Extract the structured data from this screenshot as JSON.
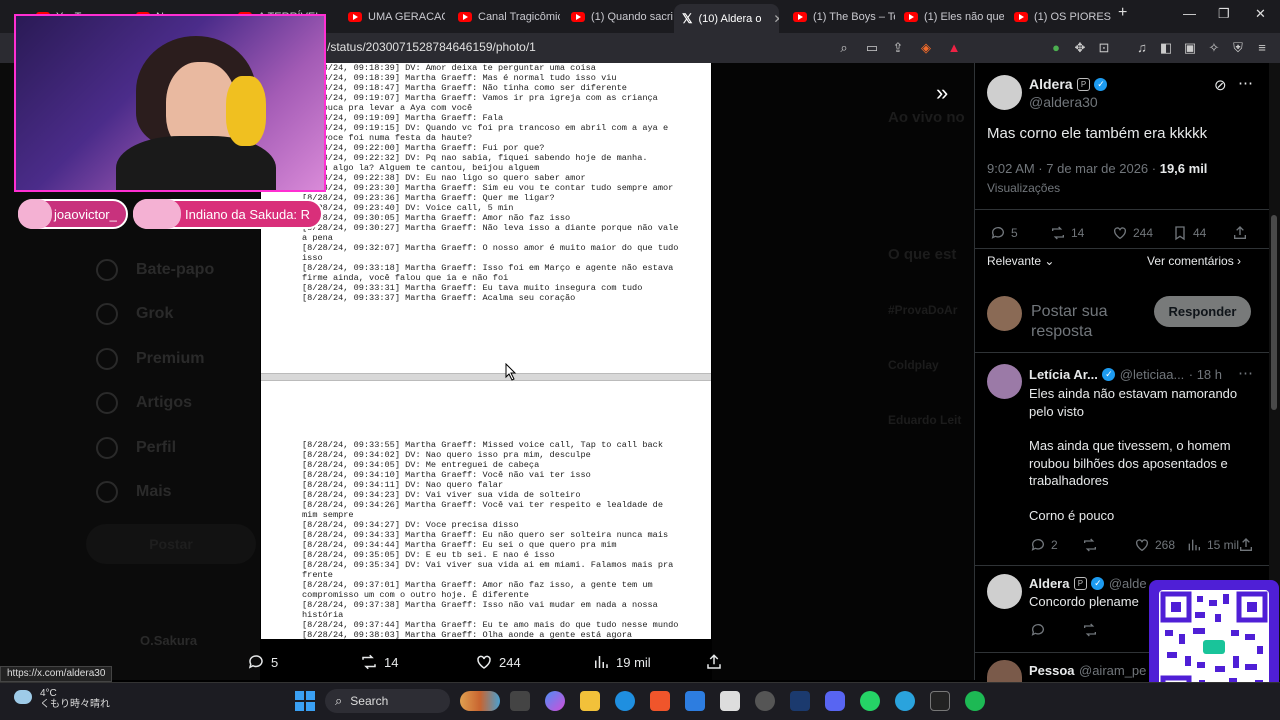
{
  "browser": {
    "tabs": [
      {
        "label": "YouTube"
      },
      {
        "label": "N..."
      },
      {
        "label": "A TERRÍVEL..."
      },
      {
        "label": "UMA GERACAO"
      },
      {
        "label": "Canal Tragicômic"
      },
      {
        "label": "(1) Quando sacri"
      },
      {
        "label": "(10) Aldera o"
      },
      {
        "label": "(1) The Boys – Te"
      },
      {
        "label": "(1) Eles não que"
      },
      {
        "label": "(1) OS PIORES D"
      }
    ],
    "new_tab": "+",
    "url": "/status/2030071528784646159/photo/1",
    "status_url": "https://x.com/aldera30"
  },
  "left_nav": {
    "items": [
      "Bate-papo",
      "Grok",
      "Premium",
      "Artigos",
      "Perfil",
      "Mais"
    ],
    "post_button": "Postar",
    "user": "O.Sakura"
  },
  "background_trends": {
    "live": "Ao vivo no",
    "section": "O que est",
    "items": [
      "#ProvaDoAr",
      "Coldplay",
      "Eduardo Leit"
    ]
  },
  "document": {
    "page1": [
      "[8/28/24, 09:18:39] DV: Amor deixa te perguntar uma coisa",
      "[8/28/24, 09:18:39] Martha Graeff: Mas é normal tudo isso viu",
      "[8/28/24, 09:18:47] Martha Graeff: Não tinha como ser diferente",
      "[8/28/24, 09:19:07] Martha Graeff: Vamos ir pra igreja com as criança",
      "e! Louca pra levar a Aya com você",
      "[8/28/24, 09:19:09] Martha Graeff: Fala",
      "[8/28/24, 09:19:15] DV: Quando vc foi pra trancoso em abril com a aya e",
      "ae, voce foi numa festa da haute?",
      "[8/28/24, 09:22:00] Martha Graeff: Fui por que?",
      "[8/28/24, 09:22:32] DV: Pq nao sabia, fiquei sabendo hoje de manha.",
      "teceu algo la? Alguem te cantou, beijou alguem",
      "[8/28/24, 09:22:38] DV: Eu nao ligo so quero saber amor",
      "[8/28/24, 09:23:30] Martha Graeff: Sim eu vou te contar tudo sempre amor",
      "[8/28/24, 09:23:36] Martha Graeff: Quer me ligar?",
      "[8/28/24, 09:23:40] DV: Voice call, 5 min",
      "[8/28/24, 09:30:05] Martha Graeff: Amor não faz isso",
      "[8/28/24, 09:30:27] Martha Graeff: Não leva isso a diante porque não vale",
      "a pena",
      "[8/28/24, 09:32:07] Martha Graeff: O nosso amor é muito maior do que tudo",
      "isso",
      "[8/28/24, 09:33:18] Martha Graeff: Isso foi em Março e agente não estava",
      "firme ainda, você falou que ia e não foi",
      "[8/28/24, 09:33:31] Martha Graeff: Eu tava muito insegura com tudo",
      "[8/28/24, 09:33:37] Martha Graeff: Acalma seu coração"
    ],
    "page2": [
      "[8/28/24, 09:33:55] Martha Graeff: Missed voice call, Tap to call back",
      "[8/28/24, 09:34:02] DV: Nao quero isso pra mim, desculpe",
      "[8/28/24, 09:34:05] DV: Me entreguei de cabeça",
      "[8/28/24, 09:34:10] Martha Graeff: Você não vai ter isso",
      "[8/28/24, 09:34:11] DV: Nao quero falar",
      "[8/28/24, 09:34:23] DV: Vai viver sua vida de solteiro",
      "[8/28/24, 09:34:26] Martha Graeff: Você vai ter respeito e lealdade de",
      "mim sempre",
      "[8/28/24, 09:34:27] DV: Voce precisa disso",
      "[8/28/24, 09:34:33] Martha Graeff: Eu não quero ser solteira nunca mais",
      "[8/28/24, 09:34:44] Martha Graeff: Eu sei o que quero pra mim",
      "[8/28/24, 09:35:05] DV: E eu tb sei. E nao é isso",
      "[8/28/24, 09:35:34] DV: Vai viver sua vida ai em miami. Falamos mais pra",
      "frente",
      "[8/28/24, 09:37:01] Martha Graeff: Amor não faz isso, a gente tem um",
      "compromisso um com o outro hoje. É diferente",
      "[8/28/24, 09:37:38] Martha Graeff: Isso não vai mudar em nada a nossa",
      "história",
      "[8/28/24, 09:37:44] Martha Graeff: Eu te amo mais do que tudo nesse mundo",
      "[8/28/24, 09:38:03] Martha Graeff: Olha aonde a gente está agora"
    ]
  },
  "photo_actions": {
    "replies": "5",
    "reposts": "14",
    "likes": "244",
    "views": "19 mil"
  },
  "tweet": {
    "author": "Aldera",
    "handle": "@aldera30",
    "text": "Mas corno ele também era kkkkk",
    "time": "9:02 AM · 7 de mar de 2026 · ",
    "views_count": "19,6 mil",
    "views_label": "Visualizações",
    "replies": "5",
    "reposts": "14",
    "likes": "244",
    "bookmarks": "44",
    "sort": "Relevante",
    "see_comments": "Ver comentários",
    "reply_placeholder": "Postar sua resposta",
    "reply_button": "Responder"
  },
  "replies": [
    {
      "author": "Letícia Ar...",
      "handle": "@leticiaa...",
      "time": "· 18 h",
      "p1": "Eles ainda não estavam namorando pelo visto",
      "p2": "Mas ainda que tivessem, o homem roubou bilhões dos aposentados e trabalhadores",
      "p3": "Corno é pouco",
      "replies": "2",
      "likes": "268",
      "views": "15 mil"
    },
    {
      "author": "Aldera",
      "handle": "@alde",
      "text": "Concordo plename"
    },
    {
      "author": "Pessoa",
      "handle": "@airam_pe"
    }
  ],
  "stream": {
    "chat1": "joaovictor_",
    "chat2": "Indiano da Sakuda: R"
  },
  "taskbar": {
    "weather_temp": "4°C",
    "weather_desc": "くもり時々晴れ",
    "search": "Search"
  },
  "colors": {
    "accent": "#1d9bf0",
    "stream_border": "#ff2fd2",
    "qr_bg": "#4f1fd6"
  }
}
